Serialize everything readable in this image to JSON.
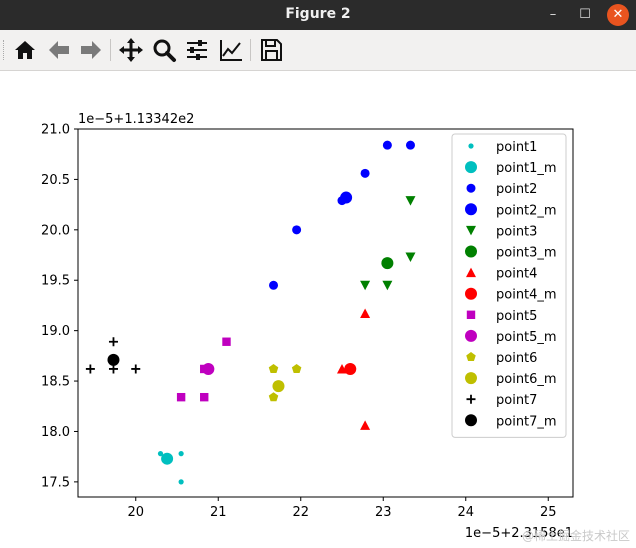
{
  "window": {
    "title": "Figure 2",
    "minimize_glyph": "–",
    "maximize_glyph": "☐",
    "close_glyph": "✕"
  },
  "toolbar": {
    "buttons": [
      "home-icon",
      "back-arrow-icon",
      "forward-arrow-icon",
      "pan-icon",
      "zoom-icon",
      "subplots-icon",
      "edit-axes-icon",
      "save-icon"
    ]
  },
  "chart_data": {
    "type": "scatter",
    "x_offset_label": "1e−5+2.3158e1",
    "y_offset_label": "1e−5+1.13342e2",
    "xlim": [
      19.3,
      25.3
    ],
    "ylim": [
      17.35,
      21.0
    ],
    "x_ticks": [
      "20",
      "21",
      "22",
      "23",
      "24",
      "25"
    ],
    "y_ticks": [
      "17.5",
      "18.0",
      "18.5",
      "19.0",
      "19.5",
      "20.0",
      "20.5",
      "21.0"
    ],
    "grid": false,
    "legend_position": "upper right",
    "series": [
      {
        "name": "point1",
        "marker": "point",
        "color": "#00bfbf",
        "points": [
          [
            20.3,
            17.78
          ],
          [
            20.55,
            17.78
          ],
          [
            20.55,
            17.5
          ]
        ]
      },
      {
        "name": "point1_m",
        "marker": "circle-big",
        "color": "#00bfbf",
        "points": [
          [
            20.38,
            17.73
          ]
        ]
      },
      {
        "name": "point2",
        "marker": "circle",
        "color": "#0000ff",
        "points": [
          [
            21.67,
            19.45
          ],
          [
            21.95,
            20.0
          ],
          [
            22.5,
            20.29
          ],
          [
            22.78,
            20.56
          ],
          [
            23.05,
            20.84
          ],
          [
            23.33,
            20.84
          ]
        ]
      },
      {
        "name": "point2_m",
        "marker": "circle-big",
        "color": "#0000ff",
        "points": [
          [
            22.55,
            20.32
          ]
        ]
      },
      {
        "name": "point3",
        "marker": "triangle-down",
        "color": "#008000",
        "points": [
          [
            22.78,
            19.45
          ],
          [
            23.05,
            19.45
          ],
          [
            23.33,
            19.73
          ],
          [
            23.33,
            20.29
          ]
        ]
      },
      {
        "name": "point3_m",
        "marker": "circle-big",
        "color": "#008000",
        "points": [
          [
            23.05,
            19.67
          ]
        ]
      },
      {
        "name": "point4",
        "marker": "triangle-up",
        "color": "#ff0000",
        "points": [
          [
            22.5,
            18.62
          ],
          [
            22.78,
            19.17
          ],
          [
            22.78,
            18.06
          ]
        ]
      },
      {
        "name": "point4_m",
        "marker": "circle-big",
        "color": "#ff0000",
        "points": [
          [
            22.6,
            18.62
          ]
        ]
      },
      {
        "name": "point5",
        "marker": "square",
        "color": "#bf00bf",
        "points": [
          [
            20.55,
            18.34
          ],
          [
            20.83,
            18.34
          ],
          [
            20.83,
            18.62
          ],
          [
            21.1,
            18.89
          ]
        ]
      },
      {
        "name": "point5_m",
        "marker": "circle-big",
        "color": "#bf00bf",
        "points": [
          [
            20.88,
            18.62
          ]
        ]
      },
      {
        "name": "point6",
        "marker": "pentagon",
        "color": "#bfbf00",
        "points": [
          [
            21.67,
            18.34
          ],
          [
            21.67,
            18.62
          ],
          [
            21.95,
            18.62
          ]
        ]
      },
      {
        "name": "point6_m",
        "marker": "circle-big",
        "color": "#bfbf00",
        "points": [
          [
            21.73,
            18.45
          ]
        ]
      },
      {
        "name": "point7",
        "marker": "plus",
        "color": "#000000",
        "points": [
          [
            19.45,
            18.62
          ],
          [
            19.73,
            18.62
          ],
          [
            20.0,
            18.62
          ],
          [
            19.73,
            18.89
          ]
        ]
      },
      {
        "name": "point7_m",
        "marker": "circle-big",
        "color": "#000000",
        "points": [
          [
            19.73,
            18.71
          ]
        ]
      }
    ]
  },
  "watermark": "@稀土掘金技术社区"
}
